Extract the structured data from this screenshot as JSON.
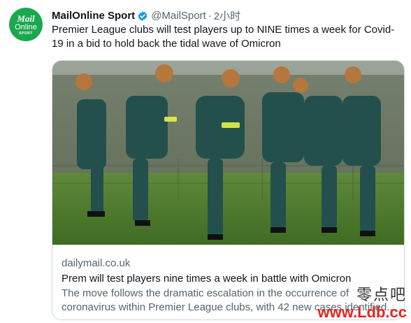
{
  "tweet": {
    "avatar": {
      "line1": "Mail",
      "line2": "Online",
      "line3": "SPORT",
      "color": "#1aa84f"
    },
    "author_name": "MailOnline Sport",
    "handle": "@MailSport",
    "separator": "·",
    "time": "2小时",
    "text": "Premier League clubs will test players up to NINE times a week for Covid-19 in a bid to hold back the tidal wave of Omicron"
  },
  "card": {
    "image_icon": "football-training-photo",
    "domain": "dailymail.co.uk",
    "title": "Prem will test players nine times a week in battle with Omicron",
    "description": "The move follows the dramatic escalation in the occurrence of coronavirus within Premier League clubs, with 42 new cases identified..."
  },
  "watermark": {
    "chinese": "零点吧",
    "url": "www.Ldb.cc"
  },
  "colors": {
    "verified": "#1d9bf0",
    "muted": "#536471",
    "border": "#cfd9de",
    "watermark_red": "#e0251f"
  }
}
